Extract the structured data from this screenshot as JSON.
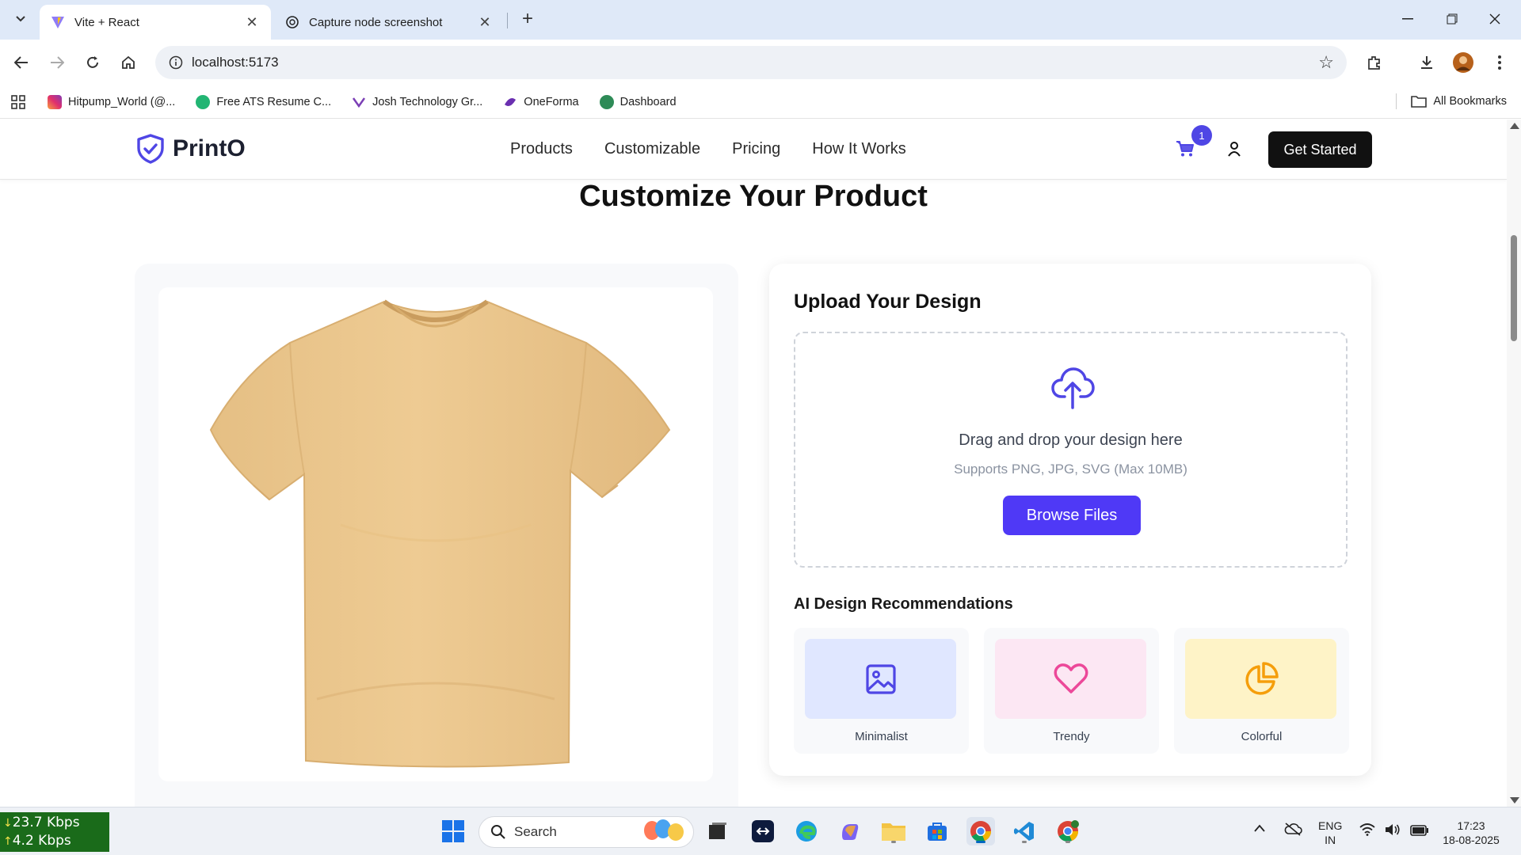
{
  "browser": {
    "tabs": [
      {
        "title": "Vite + React",
        "active": true
      },
      {
        "title": "Capture node screenshot",
        "active": false
      }
    ],
    "url": "localhost:5173",
    "bookmarks": [
      {
        "label": "Hitpump_World (@...",
        "icon": "instagram-icon",
        "color": "#e1306c"
      },
      {
        "label": "Free ATS Resume C...",
        "icon": "resume-icon",
        "color": "#22b573"
      },
      {
        "label": "Josh Technology Gr...",
        "icon": "josh-icon",
        "color": "#7b3fb5"
      },
      {
        "label": "OneForma",
        "icon": "oneforma-icon",
        "color": "#6a2fb0"
      },
      {
        "label": "Dashboard",
        "icon": "dashboard-icon",
        "color": "#2e8b57"
      }
    ],
    "all_bookmarks": "All Bookmarks"
  },
  "site": {
    "brand": "PrintO",
    "nav": [
      "Products",
      "Customizable",
      "Pricing",
      "How It Works"
    ],
    "cart_count": "1",
    "cta": "Get Started",
    "accent": "#4f46e5"
  },
  "page": {
    "title": "Customize Your Product",
    "product_color": "#ecc891",
    "upload": {
      "title": "Upload Your Design",
      "drop_text": "Drag and drop your design here",
      "supports": "Supports PNG, JPG, SVG (Max 10MB)",
      "button": "Browse Files"
    },
    "ai": {
      "title": "AI Design Recommendations",
      "items": [
        {
          "label": "Minimalist",
          "icon": "image-icon",
          "bg": "#e0e7ff",
          "color": "#4f46e5"
        },
        {
          "label": "Trendy",
          "icon": "heart-icon",
          "bg": "#fce7f3",
          "color": "#ec4899"
        },
        {
          "label": "Colorful",
          "icon": "pie-chart-icon",
          "bg": "#fef3c7",
          "color": "#f59e0b"
        }
      ]
    }
  },
  "taskbar": {
    "net_down": "23.7 Kbps",
    "net_up": "4.2 Kbps",
    "search": "Search",
    "lang_top": "ENG",
    "lang_bottom": "IN",
    "time": "17:23",
    "date": "18-08-2025"
  }
}
